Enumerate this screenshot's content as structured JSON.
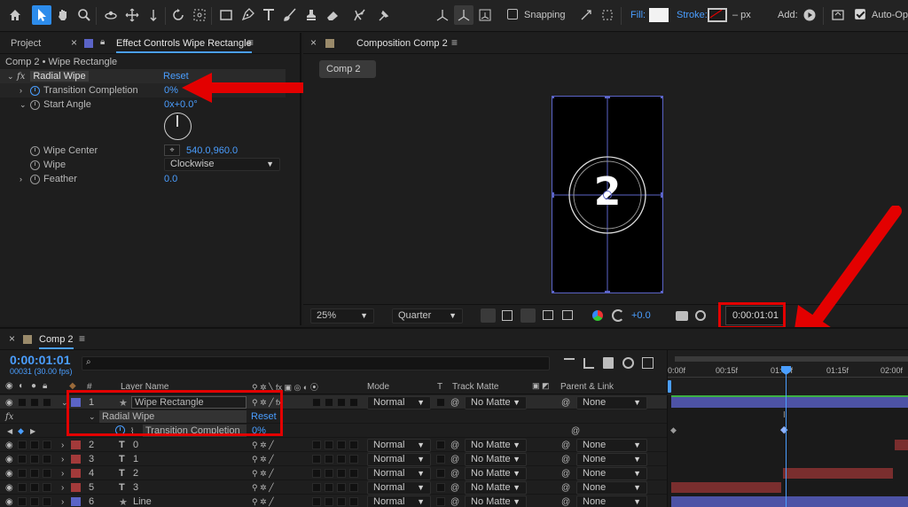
{
  "toolbar": {
    "snapping_label": "Snapping",
    "fill_label": "Fill:",
    "stroke_label": "Stroke:",
    "stroke_value": "– px",
    "add_label": "Add:",
    "auto_open_label": "Auto-Op"
  },
  "left_panel": {
    "tab_project": "Project",
    "tab_effect_controls": "Effect Controls Wipe Rectangle",
    "breadcrumb": "Comp 2 • Wipe Rectangle",
    "effect_name": "Radial Wipe",
    "reset_label": "Reset",
    "properties": [
      {
        "name": "Transition Completion",
        "value": "0%"
      },
      {
        "name": "Start Angle",
        "value": "0x+0.0°"
      },
      {
        "name": "Wipe Center",
        "value": "540.0,960.0"
      },
      {
        "name": "Wipe",
        "value": "Clockwise"
      },
      {
        "name": "Feather",
        "value": "0.0"
      }
    ]
  },
  "comp_panel": {
    "tab_title": "Composition Comp 2",
    "comp_tab": "Comp 2",
    "preview_number": "2",
    "zoom": "25%",
    "resolution": "Quarter",
    "exposure": "+0.0",
    "timecode": "0:00:01:01"
  },
  "timeline": {
    "tab_title": "Comp 2",
    "timecode": "0:00:01:01",
    "fps": "00031 (30.00 fps)",
    "headers": {
      "num": "#",
      "layer_name": "Layer Name",
      "mode": "Mode",
      "t": "T",
      "track_matte": "Track Matte",
      "parent_link": "Parent & Link"
    },
    "ruler": [
      "0:00f",
      "00:15f",
      "01:00f",
      "01:15f",
      "02:00f"
    ],
    "effect_name": "Radial Wipe",
    "reset_label": "Reset",
    "property_name": "Transition Completion",
    "property_value": "0%",
    "layers": [
      {
        "num": "1",
        "name": "Wipe Rectangle",
        "mode": "Normal",
        "matte": "No Matte",
        "parent": "None"
      },
      {
        "num": "2",
        "name": "0",
        "mode": "Normal",
        "matte": "No Matte",
        "parent": "None"
      },
      {
        "num": "3",
        "name": "1",
        "mode": "Normal",
        "matte": "No Matte",
        "parent": "None"
      },
      {
        "num": "4",
        "name": "2",
        "mode": "Normal",
        "matte": "No Matte",
        "parent": "None"
      },
      {
        "num": "5",
        "name": "3",
        "mode": "Normal",
        "matte": "No Matte",
        "parent": "None"
      },
      {
        "num": "6",
        "name": "Line",
        "mode": "Normal",
        "matte": "No Matte",
        "parent": "None"
      }
    ]
  },
  "colors": {
    "accent": "#2d8ceb",
    "annotation_red": "#e30000",
    "layer_label_blue": "#5b64c7",
    "layer_label_red": "#a33a3a"
  }
}
